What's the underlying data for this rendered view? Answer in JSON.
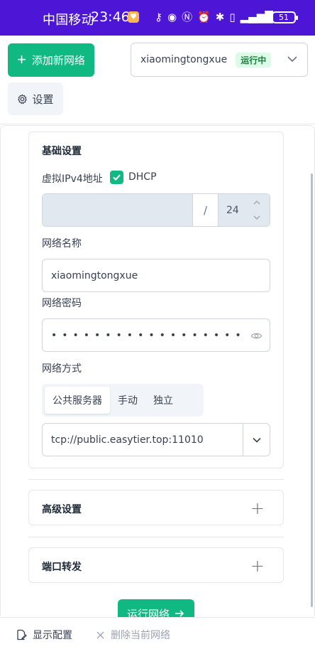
{
  "statusbar": {
    "carrier": "中国移动",
    "time": "23:46",
    "battery": "51"
  },
  "header": {
    "add_network_label": "添加新网络",
    "network_name": "xiaomingtongxue",
    "network_status": "运行中",
    "settings_label": "设置"
  },
  "basic": {
    "title": "基础设置",
    "ipv4_label": "虚拟IPv4地址",
    "dhcp_label": "DHCP",
    "dhcp_checked": true,
    "ipv4_value": "",
    "slash": "/",
    "netmask": "24",
    "name_label": "网络名称",
    "name_value": "xiaomingtongxue",
    "secret_label": "网络密码",
    "secret_dots": "••••••••••••••••••",
    "mode_label": "网络方式",
    "modes": [
      "公共服务器",
      "手动",
      "独立"
    ],
    "active_mode": "公共服务器",
    "server_value": "tcp://public.easytier.top:11010"
  },
  "advanced": {
    "title": "高级设置"
  },
  "port_forward": {
    "title": "端口转发"
  },
  "run_label": "运行网络",
  "footer": {
    "show_config": "显示配置",
    "delete_network": "删除当前网络"
  },
  "colors": {
    "accent": "#10b981",
    "statusbar": "#4d16d6",
    "running_bg": "#dcfce7",
    "running_text": "#15803d"
  }
}
